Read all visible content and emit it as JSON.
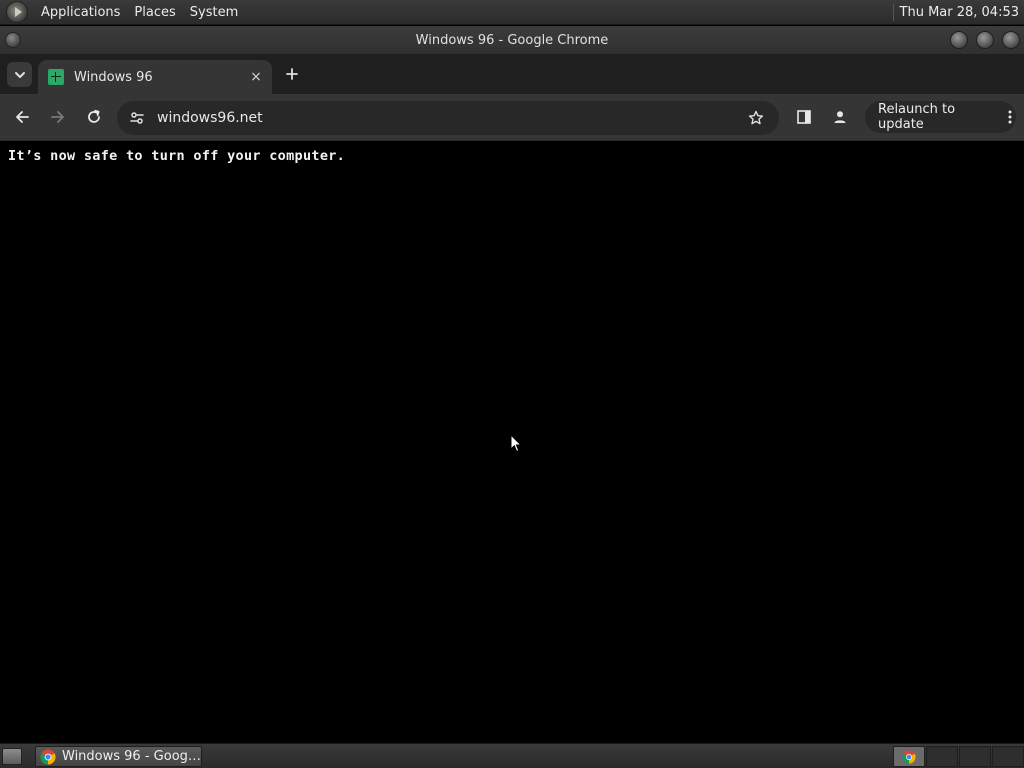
{
  "desktop_panel": {
    "menus": [
      "Applications",
      "Places",
      "System"
    ],
    "clock": "Thu Mar 28, 04:53"
  },
  "window": {
    "title": "Windows 96 - Google Chrome"
  },
  "browser": {
    "tab": {
      "title": "Windows 96",
      "favicon": "windows96-favicon",
      "close_glyph": "×"
    },
    "new_tab_glyph": "+",
    "toolbar": {
      "back_icon": "arrow-left-icon",
      "forward_icon": "arrow-right-icon",
      "reload_icon": "reload-icon",
      "url": "windows96.net",
      "site_info_icon": "tune-icon",
      "bookmark_icon": "star-icon",
      "side_panel_icon": "side-panel-icon",
      "profile_icon": "person-icon",
      "relaunch_label": "Relaunch to update"
    }
  },
  "page": {
    "message": "It’s now safe to turn off your computer."
  },
  "taskbar": {
    "window_button_label": "Windows 96 - Goog…",
    "workspaces": 4,
    "active_workspace": 1
  },
  "colors": {
    "page_background": "#000000",
    "message_text": "#f2f2f2",
    "chrome_frame": "#1f1f1f",
    "chrome_toolbar": "#353535",
    "omnibox": "#282828",
    "favicon_green": "#2aa866"
  }
}
